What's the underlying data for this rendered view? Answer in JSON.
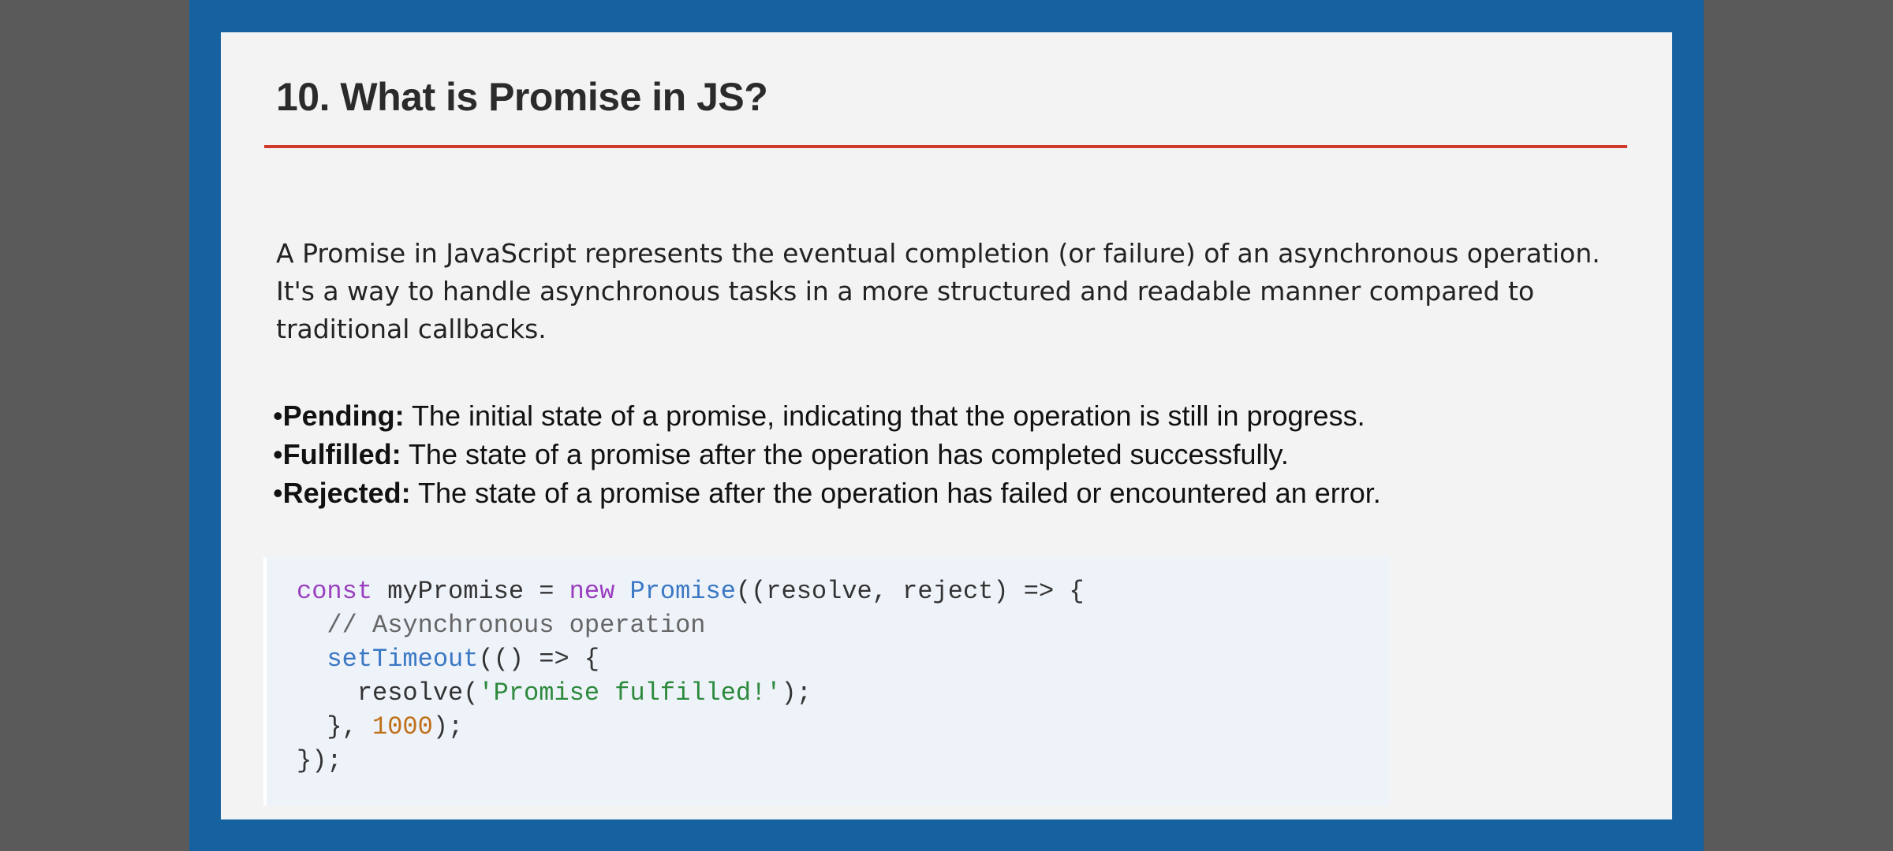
{
  "slide": {
    "title": "10. What is Promise in JS?",
    "intro": "A Promise in JavaScript represents the eventual completion (or failure) of an asynchronous operation. It's a way to handle asynchronous tasks in a more structured and readable manner compared to traditional callbacks.",
    "states": [
      {
        "bullet": "•",
        "term": "Pending:",
        "desc": " The initial state of a promise, indicating that the operation is still in progress."
      },
      {
        "bullet": "•",
        "term": "Fulfilled:",
        "desc": " The state of a promise after the operation has completed successfully."
      },
      {
        "bullet": "•",
        "term": "Rejected:",
        "desc": " The state of a promise after the operation has failed or encountered an error."
      }
    ],
    "code": {
      "l1": {
        "kw1": "const",
        "t1": " myPromise = ",
        "kw2": "new",
        "t2": " ",
        "fn": "Promise",
        "t3": "((resolve, reject) => {"
      },
      "l2": {
        "indent": "  ",
        "comment": "// Asynchronous operation"
      },
      "l3": {
        "indent": "  ",
        "fn": "setTimeout",
        "t1": "(() => {"
      },
      "l4": {
        "indent": "    ",
        "t1": "resolve(",
        "str": "'Promise fulfilled!'",
        "t2": ");"
      },
      "l5": {
        "indent": "  ",
        "t1": "}, ",
        "num": "1000",
        "t2": ");"
      },
      "l6": {
        "t1": "});"
      }
    }
  },
  "colors": {
    "frame": "#1661a0",
    "rule": "#d03a2c",
    "keyword": "#9a3fbf",
    "function": "#3a78c4",
    "string": "#2c8a3c",
    "number": "#c0701a"
  }
}
